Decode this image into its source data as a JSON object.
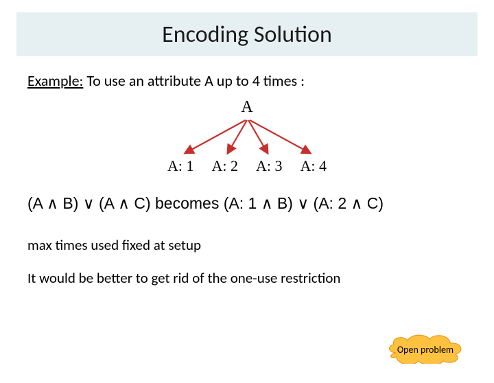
{
  "title": "Encoding Solution",
  "example": {
    "prefix": "Example:",
    "text_before_attr": " To use an attribute ",
    "attr": "A",
    "text_after_attr": " up to 4 times :"
  },
  "tree": {
    "root": "A",
    "leaves": [
      "A: 1",
      "A: 2",
      "A: 3",
      "A: 4"
    ]
  },
  "formula": {
    "lhs_open": "(A ",
    "and1": "∧",
    "lhs_mid1": " B) ",
    "or1": "∨",
    "lhs_mid2": " (A ",
    "and2": "∧",
    "lhs_close": " C) becomes (A: 1 ",
    "and3": "∧",
    "rhs_mid1": " B) ",
    "or2": "∨",
    "rhs_mid2": " (A: 2 ",
    "and4": "∧",
    "rhs_close": " C)"
  },
  "line_max": "max times used fixed at setup",
  "line_better": "It would be better to get rid of the one-use restriction",
  "callout": "Open problem",
  "colors": {
    "title_band": "#e6eff2",
    "arrow": "#c62f2c",
    "callout_fill": "#fec240",
    "callout_stroke": "#e89a18"
  }
}
